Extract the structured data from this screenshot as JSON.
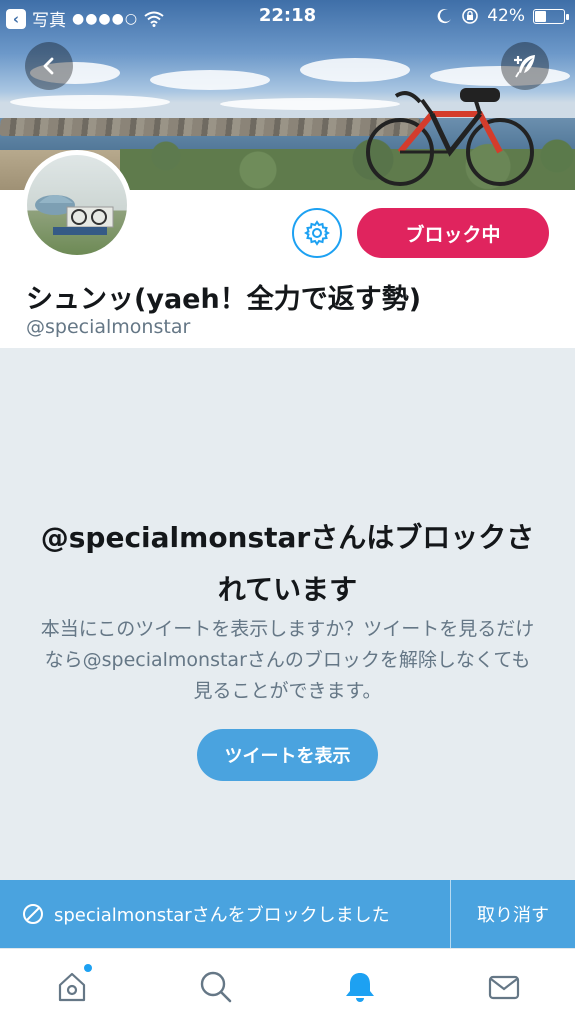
{
  "status_bar": {
    "back_app": "写真",
    "time": "22:18",
    "battery": "42%",
    "battery_level": 0.42
  },
  "profile": {
    "display_name": "シュンッ(yaeh！全力で返す勢)",
    "handle": "@specialmonstar",
    "block_button_label": "ブロック中"
  },
  "blocked_notice": {
    "title": "@specialmonstarさんはブロックされています",
    "description": "本当にこのツイートを表示しますか？ツイートを見るだけなら@specialmonstarさんのブロックを解除しなくても見ることができます。",
    "show_button_label": "ツイートを表示"
  },
  "snackbar": {
    "message": "specialmonstarさんをブロックしました",
    "undo_label": "取り消す"
  },
  "tabbar": {
    "items": [
      "home-icon",
      "search-icon",
      "notifications-icon",
      "messages-icon"
    ],
    "active_index": 2
  },
  "colors": {
    "accent": "#1da1f2",
    "block": "#e0245e",
    "snackbar": "#4aa3df",
    "background": "#e6ecf0"
  }
}
